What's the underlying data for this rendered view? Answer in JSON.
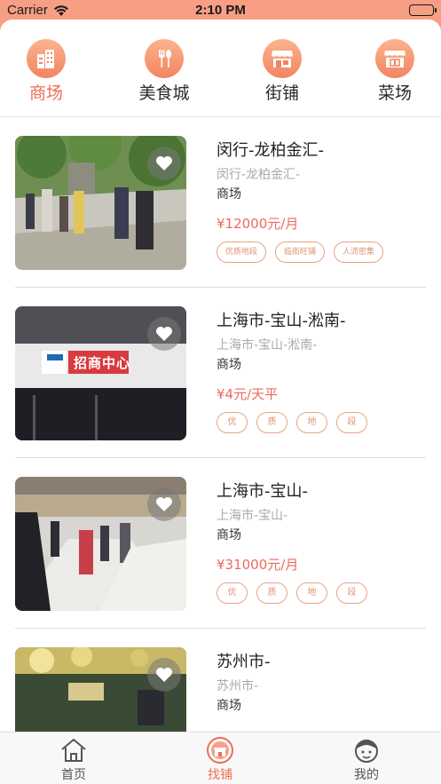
{
  "status": {
    "carrier": "Carrier",
    "time": "2:10 PM"
  },
  "categories": [
    {
      "label": "商场",
      "icon": "building-icon",
      "active": true
    },
    {
      "label": "美食城",
      "icon": "fork-spoon-icon",
      "active": false
    },
    {
      "label": "街铺",
      "icon": "storefront-icon",
      "active": false
    },
    {
      "label": "菜场",
      "icon": "market-stall-icon",
      "active": false
    }
  ],
  "listings": [
    {
      "title": "闵行-龙柏金汇-",
      "subtitle": "闵行-龙柏金汇-",
      "type": "商场",
      "price": "¥12000元/月",
      "tags": [
        "优质地段",
        "临街旺铺",
        "人流密集"
      ],
      "image": "street-crowd-photo"
    },
    {
      "title": "上海市-宝山-淞南-",
      "subtitle": "上海市-宝山-淞南-",
      "type": "商场",
      "price": "¥4元/天平",
      "tags": [
        "优",
        "质",
        "地",
        "段"
      ],
      "image": "leasing-center-photo",
      "sign_text": "招商中心"
    },
    {
      "title": "上海市-宝山-",
      "subtitle": "上海市-宝山-",
      "type": "商场",
      "price": "¥31000元/月",
      "tags": [
        "优",
        "质",
        "地",
        "段"
      ],
      "image": "mall-interior-photo"
    },
    {
      "title": "苏州市-",
      "subtitle": "苏州市-",
      "type": "商场",
      "price": "",
      "tags": [],
      "image": "food-court-photo"
    }
  ],
  "tabbar": [
    {
      "label": "首页",
      "icon": "home-icon",
      "active": false
    },
    {
      "label": "找铺",
      "icon": "find-shop-icon",
      "active": true
    },
    {
      "label": "我的",
      "icon": "profile-icon",
      "active": false
    }
  ],
  "colors": {
    "accent": "#f06d54",
    "header": "#f79e84",
    "price": "#ec6a5c",
    "tag": "#e09275"
  }
}
